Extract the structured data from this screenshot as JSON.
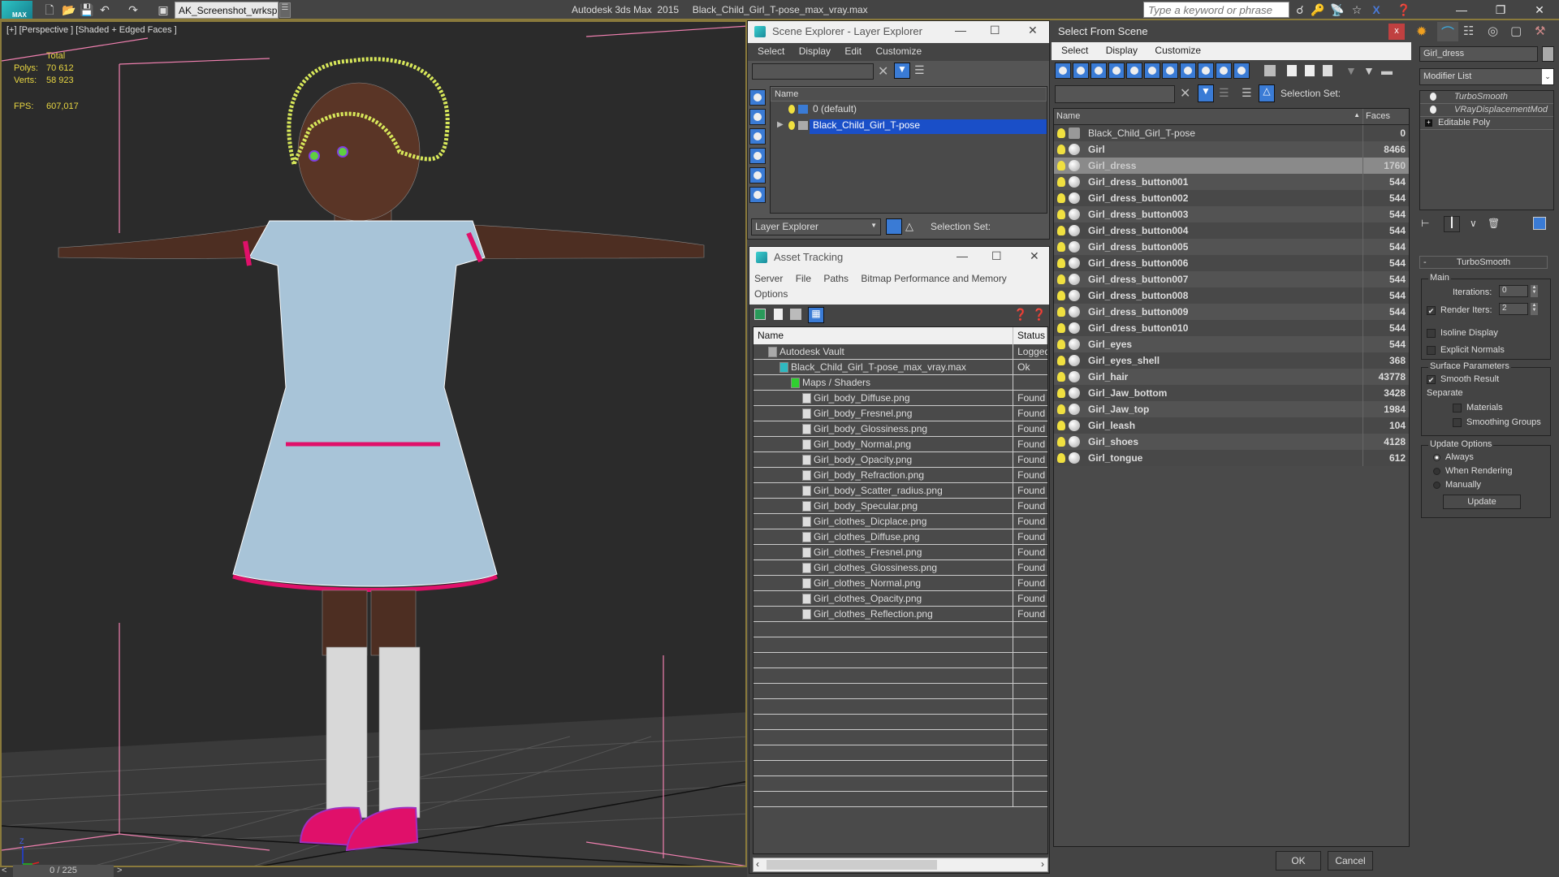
{
  "titlebar": {
    "logo": "MAX",
    "workspace": "AK_Screenshot_wrksp",
    "app_title": "Autodesk 3ds Max  2015     Black_Child_Girl_T-pose_max_vray.max",
    "search_placeholder": "Type a keyword or phrase",
    "icons": [
      "new-file-icon",
      "open-file-icon",
      "save-icon",
      "undo-icon",
      "redo-icon",
      "project-folder-icon"
    ],
    "right_icons": [
      "binoculars-icon",
      "key-icon",
      "satellite-icon",
      "star-icon",
      "close-x-icon",
      "help-icon"
    ]
  },
  "viewport": {
    "label": "[+] [Perspective ] [Shaded + Edged Faces ]",
    "stats": {
      "total_label": "Total",
      "polys_label": "Polys:",
      "polys": "70 612",
      "verts_label": "Verts:",
      "verts": "58 923",
      "fps_label": "FPS:",
      "fps": "607,017"
    },
    "colors": {
      "hair": "#d8e85a",
      "dress_trim": "#e0106a",
      "shoes": "#e0106a",
      "skin": "#5a3526",
      "grid": "#444444"
    }
  },
  "timeline": {
    "prev": "<",
    "position": "0 / 225",
    "next": ">"
  },
  "scene_explorer": {
    "title": "Scene Explorer - Layer Explorer",
    "menu": [
      "Select",
      "Display",
      "Edit",
      "Customize"
    ],
    "column_name": "Name",
    "layers": [
      {
        "name": "0 (default)",
        "selected": false
      },
      {
        "name": "Black_Child_Girl_T-pose",
        "selected": true
      }
    ],
    "explorer_dropdown": "Layer Explorer",
    "selection_set_label": "Selection Set:"
  },
  "asset_tracking": {
    "title": "Asset Tracking",
    "menu": [
      "Server",
      "File",
      "Paths",
      "Bitmap Performance and Memory",
      "Options"
    ],
    "columns": [
      "Name",
      "Status"
    ],
    "rows": [
      {
        "name": "Autodesk Vault",
        "status": "Logged",
        "indent": 0,
        "icon": "vault-icon"
      },
      {
        "name": "Black_Child_Girl_T-pose_max_vray.max",
        "status": "Ok",
        "indent": 1,
        "icon": "max-file-icon"
      },
      {
        "name": "Maps / Shaders",
        "status": "",
        "indent": 2,
        "icon": "maps-icon"
      },
      {
        "name": "Girl_body_Diffuse.png",
        "status": "Found",
        "indent": 3,
        "icon": "image-file-icon"
      },
      {
        "name": "Girl_body_Fresnel.png",
        "status": "Found",
        "indent": 3,
        "icon": "image-file-icon"
      },
      {
        "name": "Girl_body_Glossiness.png",
        "status": "Found",
        "indent": 3,
        "icon": "image-file-icon"
      },
      {
        "name": "Girl_body_Normal.png",
        "status": "Found",
        "indent": 3,
        "icon": "image-file-icon"
      },
      {
        "name": "Girl_body_Opacity.png",
        "status": "Found",
        "indent": 3,
        "icon": "image-file-icon"
      },
      {
        "name": "Girl_body_Refraction.png",
        "status": "Found",
        "indent": 3,
        "icon": "image-file-icon"
      },
      {
        "name": "Girl_body_Scatter_radius.png",
        "status": "Found",
        "indent": 3,
        "icon": "image-file-icon"
      },
      {
        "name": "Girl_body_Specular.png",
        "status": "Found",
        "indent": 3,
        "icon": "image-file-icon"
      },
      {
        "name": "Girl_clothes_Dicplace.png",
        "status": "Found",
        "indent": 3,
        "icon": "image-file-icon"
      },
      {
        "name": "Girl_clothes_Diffuse.png",
        "status": "Found",
        "indent": 3,
        "icon": "image-file-icon"
      },
      {
        "name": "Girl_clothes_Fresnel.png",
        "status": "Found",
        "indent": 3,
        "icon": "image-file-icon"
      },
      {
        "name": "Girl_clothes_Glossiness.png",
        "status": "Found",
        "indent": 3,
        "icon": "image-file-icon"
      },
      {
        "name": "Girl_clothes_Normal.png",
        "status": "Found",
        "indent": 3,
        "icon": "image-file-icon"
      },
      {
        "name": "Girl_clothes_Opacity.png",
        "status": "Found",
        "indent": 3,
        "icon": "image-file-icon"
      },
      {
        "name": "Girl_clothes_Reflection.png",
        "status": "Found",
        "indent": 3,
        "icon": "image-file-icon"
      }
    ]
  },
  "select_from_scene": {
    "title": "Select From Scene",
    "close": "x",
    "menu": [
      "Select",
      "Display",
      "Customize"
    ],
    "selection_set_label": "Selection Set:",
    "columns": [
      "Name",
      "Faces"
    ],
    "rows": [
      {
        "name": "Black_Child_Girl_T-pose",
        "faces": "0",
        "type": "group",
        "selected": false
      },
      {
        "name": "Girl",
        "faces": "8466",
        "type": "geometry",
        "selected": false
      },
      {
        "name": "Girl_dress",
        "faces": "1760",
        "type": "geometry",
        "selected": true
      },
      {
        "name": "Girl_dress_button001",
        "faces": "544",
        "type": "geometry",
        "selected": false
      },
      {
        "name": "Girl_dress_button002",
        "faces": "544",
        "type": "geometry",
        "selected": false
      },
      {
        "name": "Girl_dress_button003",
        "faces": "544",
        "type": "geometry",
        "selected": false
      },
      {
        "name": "Girl_dress_button004",
        "faces": "544",
        "type": "geometry",
        "selected": false
      },
      {
        "name": "Girl_dress_button005",
        "faces": "544",
        "type": "geometry",
        "selected": false
      },
      {
        "name": "Girl_dress_button006",
        "faces": "544",
        "type": "geometry",
        "selected": false
      },
      {
        "name": "Girl_dress_button007",
        "faces": "544",
        "type": "geometry",
        "selected": false
      },
      {
        "name": "Girl_dress_button008",
        "faces": "544",
        "type": "geometry",
        "selected": false
      },
      {
        "name": "Girl_dress_button009",
        "faces": "544",
        "type": "geometry",
        "selected": false
      },
      {
        "name": "Girl_dress_button010",
        "faces": "544",
        "type": "geometry",
        "selected": false
      },
      {
        "name": "Girl_eyes",
        "faces": "544",
        "type": "geometry",
        "selected": false
      },
      {
        "name": "Girl_eyes_shell",
        "faces": "368",
        "type": "geometry",
        "selected": false
      },
      {
        "name": "Girl_hair",
        "faces": "43778",
        "type": "geometry",
        "selected": false
      },
      {
        "name": "Girl_Jaw_bottom",
        "faces": "3428",
        "type": "geometry",
        "selected": false
      },
      {
        "name": "Girl_Jaw_top",
        "faces": "1984",
        "type": "geometry",
        "selected": false
      },
      {
        "name": "Girl_leash",
        "faces": "104",
        "type": "geometry",
        "selected": false
      },
      {
        "name": "Girl_shoes",
        "faces": "4128",
        "type": "geometry",
        "selected": false
      },
      {
        "name": "Girl_tongue",
        "faces": "612",
        "type": "geometry",
        "selected": false
      }
    ],
    "ok": "OK",
    "cancel": "Cancel"
  },
  "command_panel": {
    "object_name": "Girl_dress",
    "modifier_list": "Modifier List",
    "stack": [
      {
        "name": "TurboSmooth",
        "italic": true
      },
      {
        "name": "VRayDisplacementMod",
        "italic": true
      },
      {
        "name": "Editable Poly",
        "italic": false
      }
    ],
    "rollout_title": "TurboSmooth",
    "rollout_toggle": "-",
    "main_group": "Main",
    "iterations_label": "Iterations:",
    "iterations": "0",
    "render_iters_label": "Render Iters:",
    "render_iters": "2",
    "render_iters_checked": true,
    "isoline_label": "Isoline Display",
    "isoline_checked": false,
    "explicit_normals_label": "Explicit Normals",
    "explicit_normals_checked": false,
    "surface_group": "Surface Parameters",
    "smooth_result_label": "Smooth Result",
    "smooth_result_checked": true,
    "separate_label": "Separate",
    "materials_label": "Materials",
    "materials_checked": false,
    "smoothing_groups_label": "Smoothing Groups",
    "smoothing_groups_checked": false,
    "update_group": "Update Options",
    "update_options": [
      "Always",
      "When Rendering",
      "Manually"
    ],
    "update_selected": "Always",
    "update_button": "Update"
  }
}
